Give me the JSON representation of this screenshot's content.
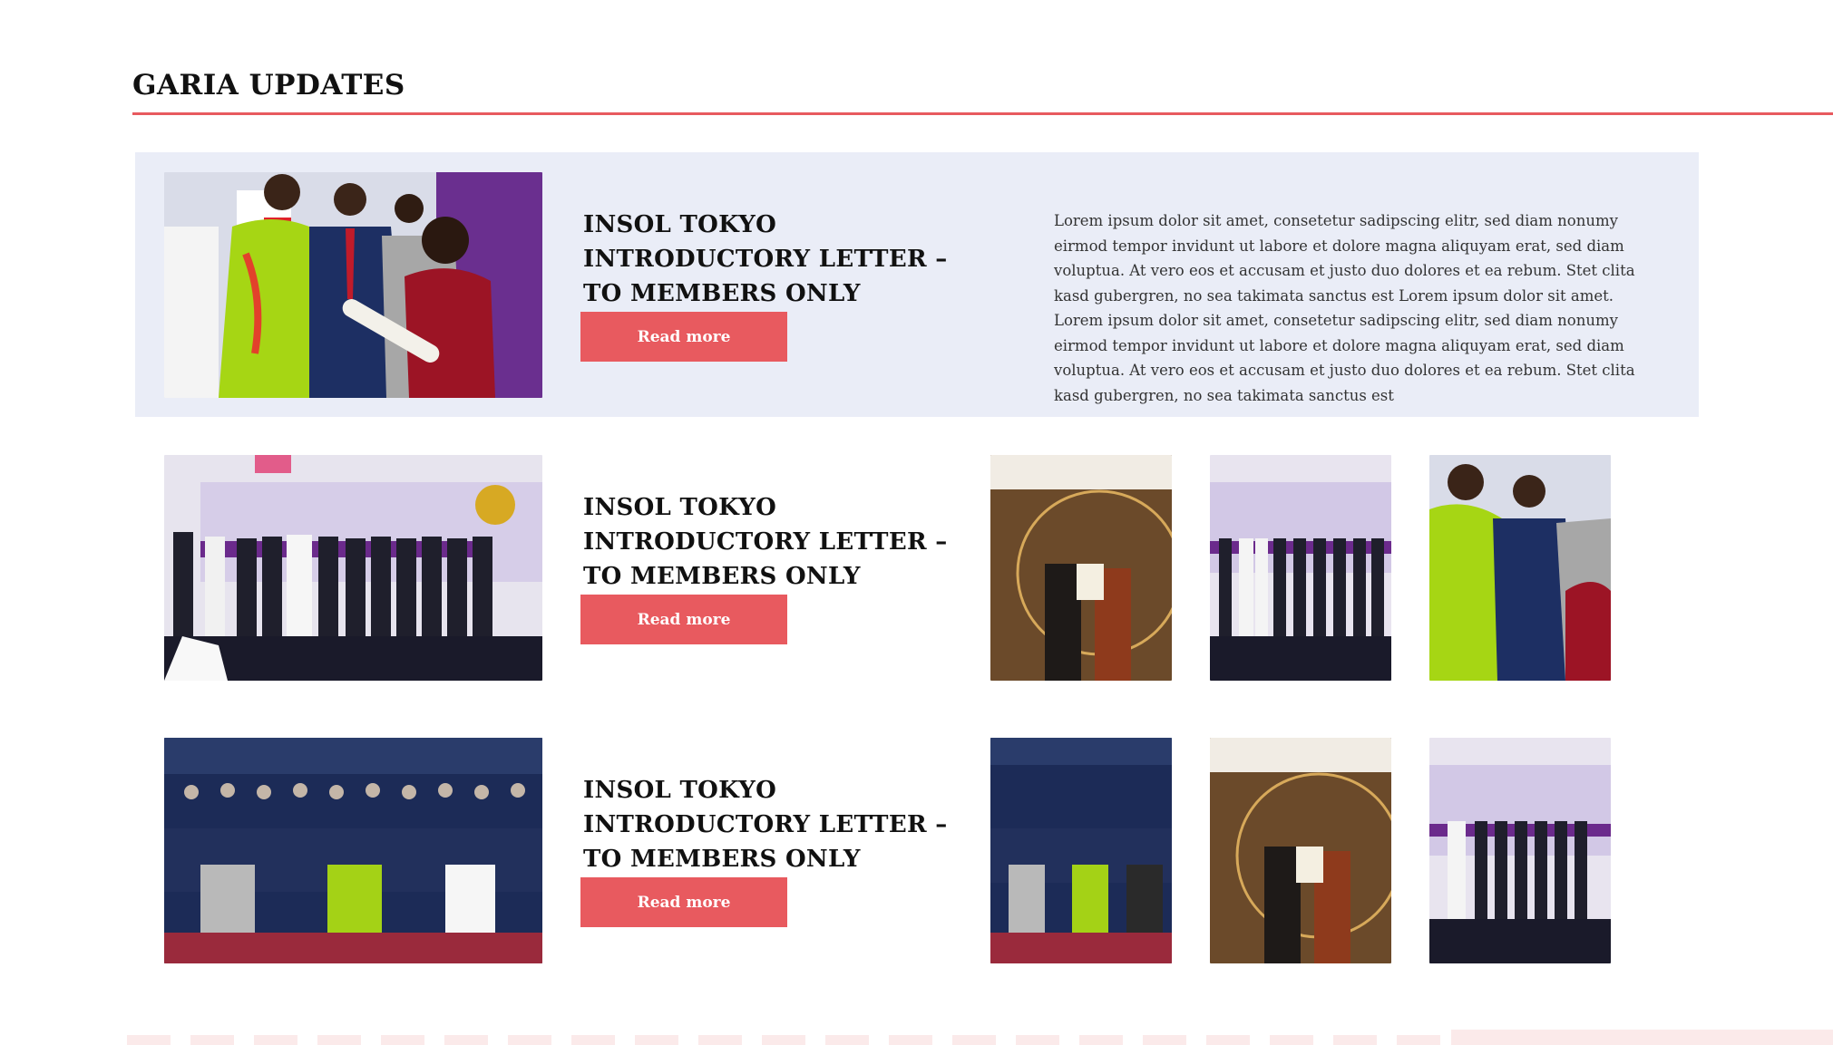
{
  "section": {
    "title": "GARIA UPDATES"
  },
  "colors": {
    "accent": "#e85a5f",
    "row_highlight": "#eaedf7",
    "deco": "#fbeaea"
  },
  "posts": [
    {
      "title": "INSOL TOKYO INTRODUCTORY LETTER – TO MEMBERS ONLY",
      "read_more": "Read more",
      "excerpt": "Lorem ipsum dolor sit amet, consetetur sadipscing elitr, sed diam nonumy eirmod tempor invidunt ut labore et dolore magna aliquyam erat, sed diam voluptua. At vero eos et accusam et justo duo dolores et ea rebum. Stet clita kasd gubergren, no sea takimata sanctus est Lorem ipsum dolor sit amet. Lorem ipsum dolor sit amet, consetetur sadipscing elitr, sed diam nonumy eirmod tempor invidunt ut labore et dolore magna aliquyam erat, sed diam voluptua. At vero eos et accusam et justo duo dolores et ea rebum. Stet clita kasd gubergren, no sea takimata sanctus est"
    },
    {
      "title": "INSOL TOKYO INTRODUCTORY LETTER – TO MEMBERS ONLY",
      "read_more": "Read more"
    },
    {
      "title": "INSOL TOKYO INTRODUCTORY LETTER – TO MEMBERS ONLY",
      "read_more": "Read more"
    }
  ]
}
